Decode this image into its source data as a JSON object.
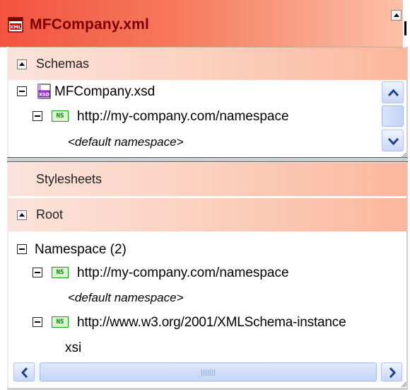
{
  "window": {
    "title": "MFCompany.xml",
    "title_icon": "xml-file-icon"
  },
  "schemas": {
    "label": "Schemas",
    "tree": {
      "file": "MFCompany.xsd",
      "file_icon": "xsd-file-icon",
      "namespace": "http://my-company.com/namespace",
      "namespace_icon": "ns-icon",
      "namespace_icon_text": "NS",
      "prefix": "<default namespace>"
    }
  },
  "stylesheets": {
    "label": "Stylesheets"
  },
  "root": {
    "label": "Root",
    "tree": {
      "group_label": "Namespace (2)",
      "items": [
        {
          "uri": "http://my-company.com/namespace",
          "icon_text": "NS",
          "prefix": "<default namespace>"
        },
        {
          "uri": "http://www.w3.org/2001/XMLSchema-instance",
          "icon_text": "NS",
          "prefix": "xsi"
        }
      ]
    }
  },
  "colors": {
    "title_bar": "#f2533f",
    "title_text": "#7a0000",
    "section_bar": "#fbc1a8",
    "ns_icon_border": "#1b9c1b",
    "scrollbar": "#c9d7f6"
  }
}
